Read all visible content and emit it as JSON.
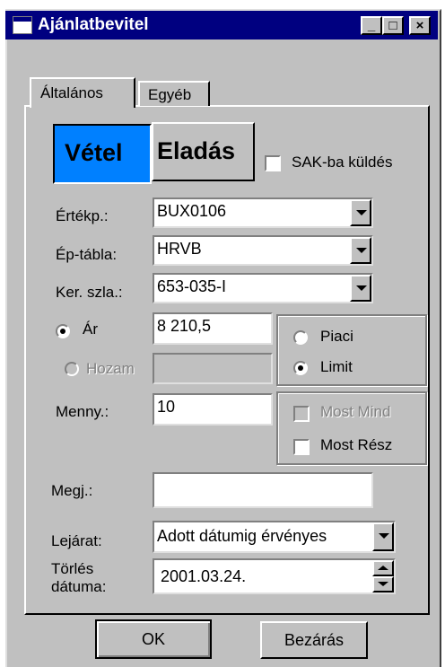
{
  "window": {
    "title": "Ajánlatbevitel",
    "min_glyph": "_",
    "max_glyph": "□",
    "close_glyph": "×"
  },
  "tabs": [
    {
      "label": "Általános",
      "active": true
    },
    {
      "label": "Egyéb",
      "active": false
    }
  ],
  "side": {
    "buy_label": "Vétel",
    "sell_label": "Eladás",
    "buy_color": "#0080ff",
    "selected": "Vétel"
  },
  "sak": {
    "label": "SAK-ba küldés",
    "checked": false
  },
  "fields": {
    "security": {
      "label": "Értékp.:",
      "value": "BUX0106"
    },
    "board": {
      "label": "Ép-tábla:",
      "value": "HRVB"
    },
    "account": {
      "label": "Ker. szla.:",
      "value": "653-035-I"
    },
    "price": {
      "label": "Ár",
      "value": "8 210,5",
      "selected": true
    },
    "yield": {
      "label": "Hozam",
      "value": "",
      "enabled": false
    },
    "quantity": {
      "label": "Menny.:",
      "value": "10"
    },
    "note": {
      "label": "Megj.:",
      "value": ""
    },
    "expiry": {
      "label": "Lejárat:",
      "value": "Adott dátumig érvényes"
    },
    "delete_date": {
      "label_line1": "Törlés",
      "label_line2": "dátuma:",
      "value": "2001.03.24."
    }
  },
  "order_type": {
    "market_label": "Piaci",
    "limit_label": "Limit",
    "selected": "Limit"
  },
  "fill": {
    "all_label": "Most Mind",
    "all_enabled": false,
    "partial_label": "Most Rész",
    "partial_checked": false
  },
  "buttons": {
    "ok": "OK",
    "close": "Bezárás"
  }
}
